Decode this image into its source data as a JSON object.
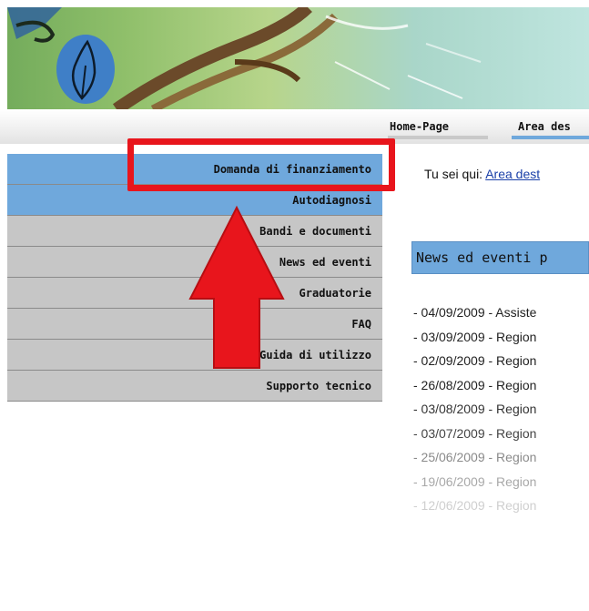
{
  "top_nav": {
    "items": [
      {
        "label": "Home-Page"
      },
      {
        "label": "Area des"
      }
    ]
  },
  "sidebar": {
    "items": [
      {
        "label": "Domanda di finanziamento"
      },
      {
        "label": "Autodiagnosi"
      },
      {
        "label": "Bandi e documenti"
      },
      {
        "label": "News ed eventi"
      },
      {
        "label": "Graduatorie"
      },
      {
        "label": "FAQ"
      },
      {
        "label": "Guida di utilizzo"
      },
      {
        "label": "Supporto tecnico"
      }
    ]
  },
  "breadcrumb": {
    "prefix": "Tu sei qui:",
    "link": "Area dest"
  },
  "news": {
    "title": "News ed eventi p",
    "items": [
      {
        "text": "- 04/09/2009 - Assiste"
      },
      {
        "text": "- 03/09/2009 - Region"
      },
      {
        "text": "- 02/09/2009 - Region"
      },
      {
        "text": "- 26/08/2009 - Region"
      },
      {
        "text": "- 03/08/2009 - Region"
      },
      {
        "text": "- 03/07/2009 - Region"
      },
      {
        "text": "- 25/06/2009 - Region"
      },
      {
        "text": "- 19/06/2009 - Region"
      },
      {
        "text": "- 12/06/2009 - Region"
      }
    ]
  },
  "colors": {
    "menu_blue": "#6fa8dc",
    "menu_gray": "#c6c6c6",
    "highlight_red": "#e8151c",
    "link_blue": "#1a3fa8"
  }
}
